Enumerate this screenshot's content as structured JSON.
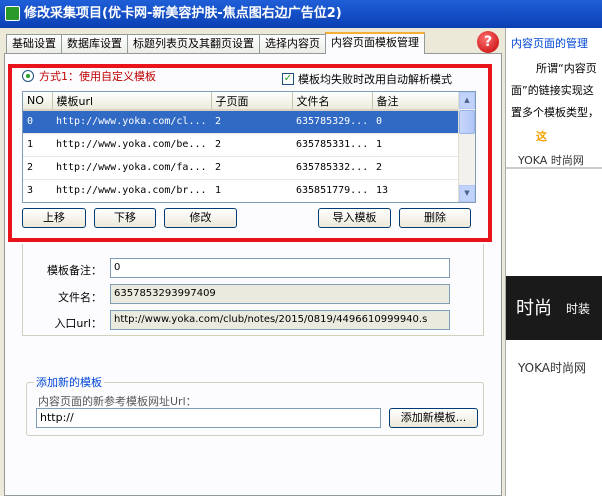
{
  "window": {
    "title": "修改采集项目(优卡网-新美容护肤-焦点图右边广告位2)"
  },
  "tabs": [
    {
      "label": "基础设置"
    },
    {
      "label": "数据库设置"
    },
    {
      "label": "标题列表页及其翻页设置"
    },
    {
      "label": "选择内容页"
    },
    {
      "label": "内容页面模板管理"
    }
  ],
  "mode": {
    "radio_label": "方式1：使用自定义模板",
    "auto_parse_label": "模板均失败时改用自动解析模式"
  },
  "grid": {
    "columns": [
      "NO",
      "模板url",
      "子页面",
      "文件名",
      "备注"
    ],
    "rows": [
      {
        "no": "0",
        "url": "http://www.yoka.com/cl...",
        "sub": "2",
        "file": "635785329...",
        "note": "0"
      },
      {
        "no": "1",
        "url": "http://www.yoka.com/be...",
        "sub": "2",
        "file": "635785331...",
        "note": "1"
      },
      {
        "no": "2",
        "url": "http://www.yoka.com/fa...",
        "sub": "2",
        "file": "635785332...",
        "note": "2"
      },
      {
        "no": "3",
        "url": "http://www.yoka.com/br...",
        "sub": "1",
        "file": "635851779...",
        "note": "13"
      }
    ]
  },
  "buttons": {
    "up": "上移",
    "down": "下移",
    "edit": "修改",
    "import": "导入模板",
    "delete": "删除",
    "add": "添加新模板..."
  },
  "detail": {
    "note_label": "模板备注：",
    "note_value": "0",
    "file_label": "文件名：",
    "file_value": "6357853293997409",
    "entry_label": "入口url：",
    "entry_value": "http://www.yoka.com/club/notes/2015/0819/4496610999940.s"
  },
  "add_section": {
    "title": "添加新的模板",
    "prompt": "内容页面的新参考模板网址Url：",
    "url_value": "http://"
  },
  "side": {
    "heading": "内容页面的管理",
    "line1": "所谓“内容页",
    "line2": "面”的链接实现这",
    "line3": "置多个模板类型，",
    "line4": "这",
    "yoka1": "YOKA 时尚网",
    "ad_big": "时尚",
    "ad_small": "时装",
    "yoka2": "YOKA时尚网"
  }
}
